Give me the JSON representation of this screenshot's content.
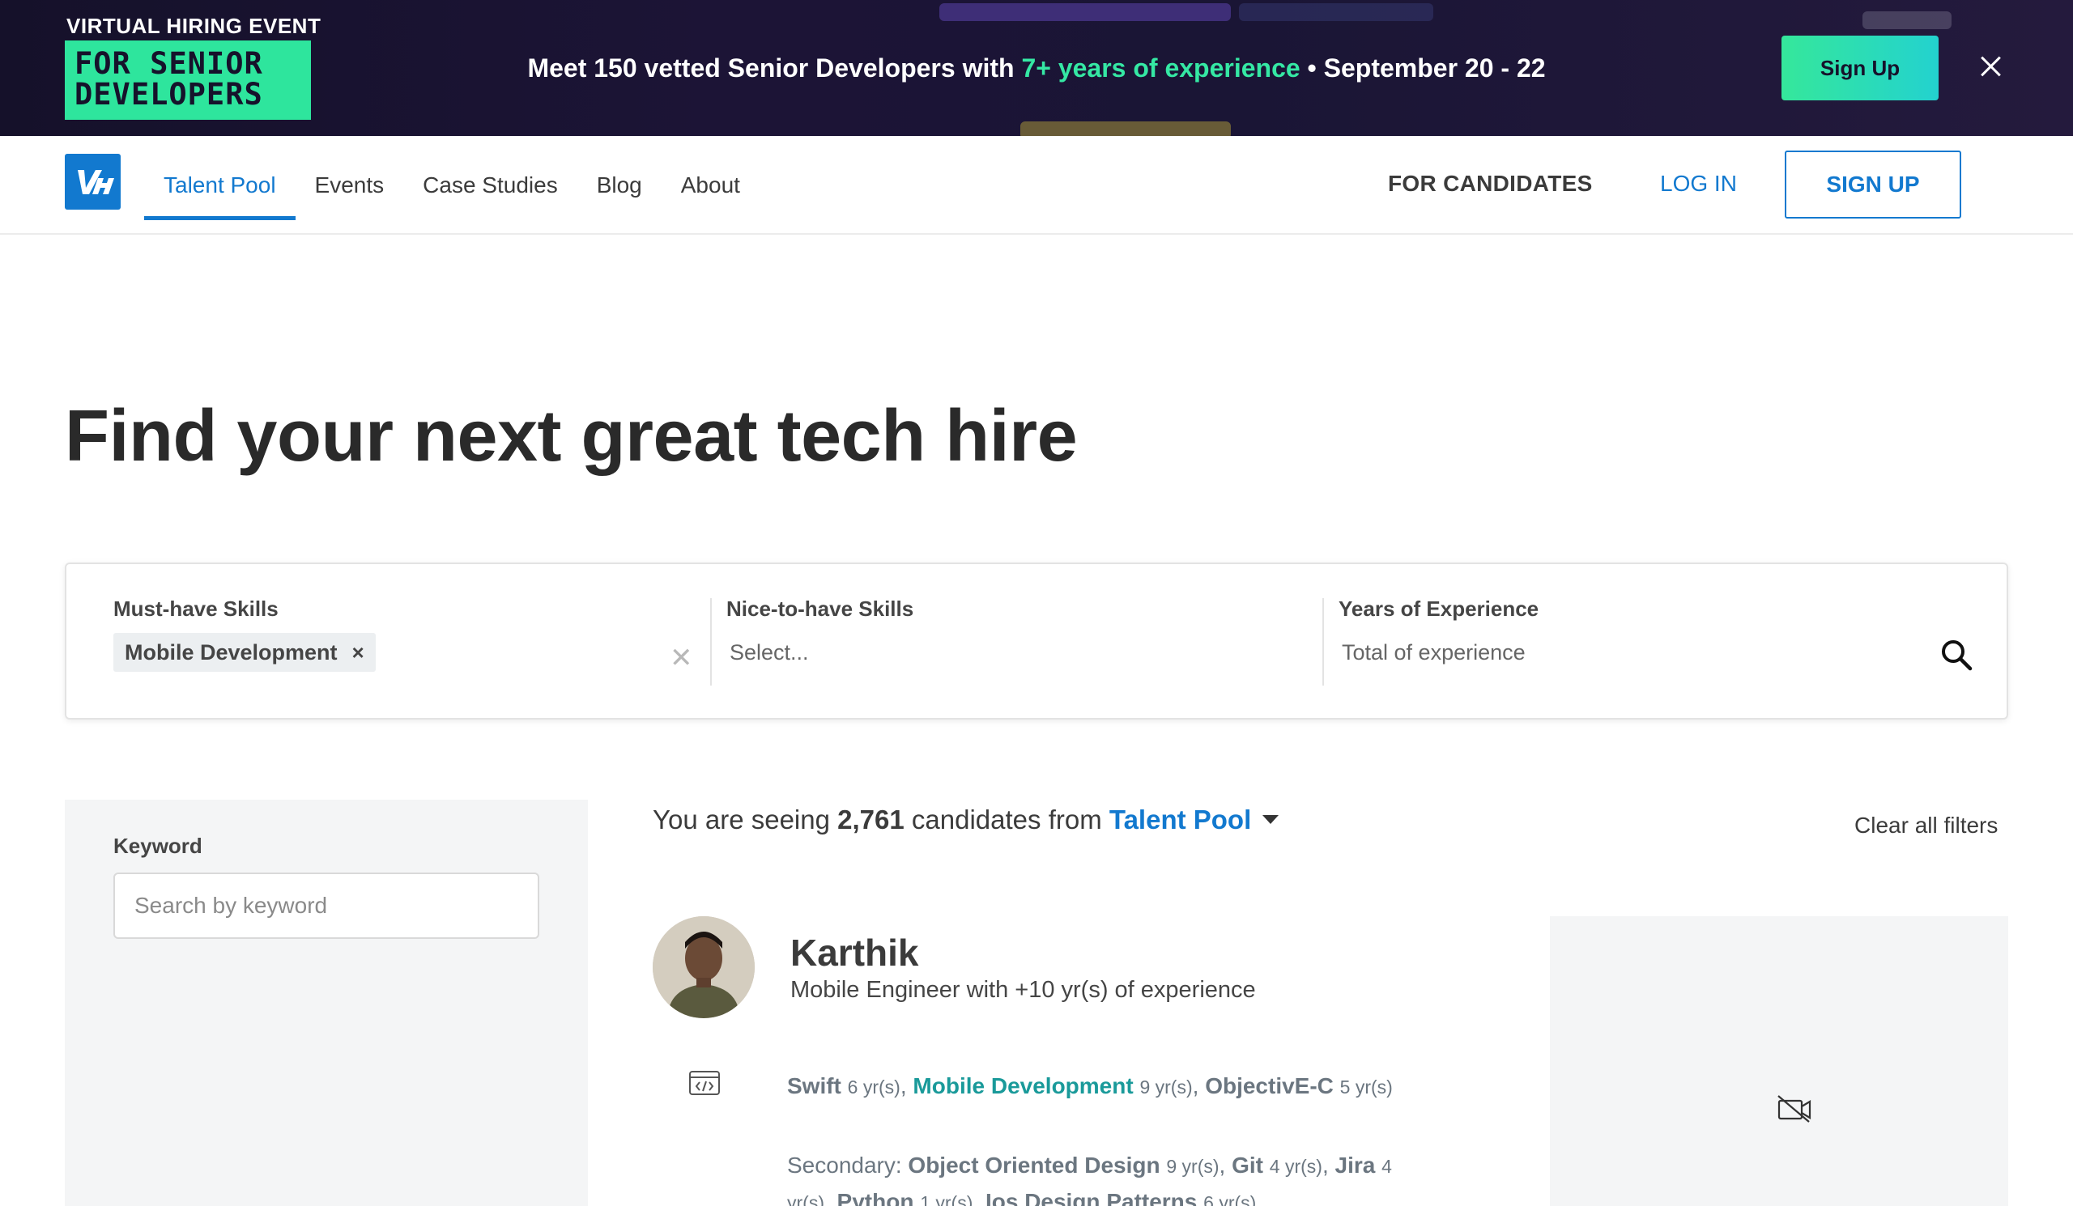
{
  "banner": {
    "kicker": "VIRTUAL HIRING EVENT",
    "badge_line1": "FOR SENIOR",
    "badge_line2": "DEVELOPERS",
    "message_prefix": "Meet 150 vetted Senior Developers with ",
    "message_highlight": "7+ years of experience",
    "message_suffix": " • September 20 - 22",
    "signup_label": "Sign Up",
    "close_icon": "close-icon"
  },
  "nav": {
    "logo_icon": "vh-logo-icon",
    "links": [
      "Talent Pool",
      "Events",
      "Case Studies",
      "Blog",
      "About"
    ],
    "active_link": "Talent Pool",
    "for_candidates": "FOR CANDIDATES",
    "login": "LOG IN",
    "signup": "SIGN UP"
  },
  "hero": {
    "title": "Find your next great tech hire"
  },
  "search": {
    "must_have_label": "Must-have Skills",
    "must_have_chip": "Mobile Development",
    "chip_remove": "×",
    "clear": "✕",
    "nice_to_have_label": "Nice-to-have Skills",
    "nice_to_have_placeholder": "Select...",
    "experience_label": "Years of Experience",
    "experience_placeholder": "Total of experience",
    "search_icon": "search-icon"
  },
  "sidebar": {
    "keyword_label": "Keyword",
    "keyword_placeholder": "Search by keyword"
  },
  "results": {
    "prefix": "You are seeing ",
    "count": "2,761",
    "middle": " candidates from ",
    "source": "Talent Pool",
    "clear_filters": "Clear all filters"
  },
  "candidate": {
    "name": "Karthik",
    "title": "Mobile Engineer with +10 yr(s) of experience",
    "primary_skills": [
      {
        "name": "Swift",
        "years": "6 yr(s)",
        "match": false
      },
      {
        "name": "Mobile Development",
        "years": "9 yr(s)",
        "match": true
      },
      {
        "name": "ObjectivE-C",
        "years": "5 yr(s)",
        "match": false
      }
    ],
    "secondary_label": "Secondary: ",
    "secondary_skills": [
      {
        "name": "Object Oriented Design",
        "years": "9 yr(s)"
      },
      {
        "name": "Git",
        "years": "4 yr(s)"
      },
      {
        "name": "Jira",
        "years": "4 yr(s)"
      },
      {
        "name": "Python",
        "years": "1 yr(s)"
      },
      {
        "name": "Ios Design Patterns",
        "years": "6 yr(s)"
      }
    ],
    "video_icon": "video-off-icon"
  },
  "colors": {
    "brand_blue": "#1279cf",
    "accent_green": "#2ee59d",
    "banner_bg": "#17122d",
    "skill_match": "#1a9a9a"
  }
}
